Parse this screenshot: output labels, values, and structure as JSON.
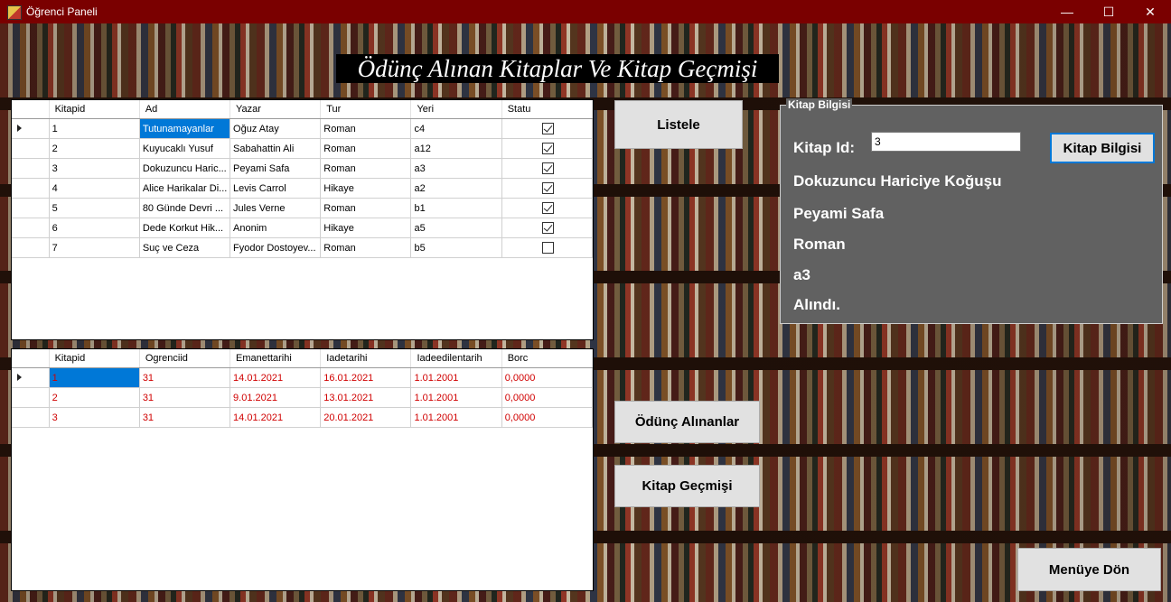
{
  "window": {
    "title": "Öğrenci Paneli",
    "minimize": "—",
    "maximize": "☐",
    "close": "✕"
  },
  "heading": "Ödünç Alınan Kitaplar Ve Kitap Geçmişi",
  "books_grid": {
    "columns": [
      "Kitapid",
      "Ad",
      "Yazar",
      "Tur",
      "Yeri",
      "Statu"
    ],
    "rows": [
      {
        "id": "1",
        "ad": "Tutunamayanlar",
        "yazar": "Oğuz Atay",
        "tur": "Roman",
        "yeri": "c4",
        "statu": true
      },
      {
        "id": "2",
        "ad": "Kuyucaklı Yusuf",
        "yazar": "Sabahattin Ali",
        "tur": "Roman",
        "yeri": "a12",
        "statu": true
      },
      {
        "id": "3",
        "ad": "Dokuzuncu Haric...",
        "yazar": "Peyami Safa",
        "tur": "Roman",
        "yeri": "a3",
        "statu": true
      },
      {
        "id": "4",
        "ad": "Alice Harikalar Di...",
        "yazar": "Levis Carrol",
        "tur": "Hikaye",
        "yeri": "a2",
        "statu": true
      },
      {
        "id": "5",
        "ad": "80 Günde Devri ...",
        "yazar": "Jules Verne",
        "tur": "Roman",
        "yeri": "b1",
        "statu": true
      },
      {
        "id": "6",
        "ad": "Dede Korkut Hik...",
        "yazar": "Anonim",
        "tur": "Hikaye",
        "yeri": "a5",
        "statu": true
      },
      {
        "id": "7",
        "ad": "Suç ve Ceza",
        "yazar": "Fyodor Dostoyev...",
        "tur": "Roman",
        "yeri": "b5",
        "statu": false
      }
    ]
  },
  "loans_grid": {
    "columns": [
      "Kitapid",
      "Ogrenciid",
      "Emanettarihi",
      "Iadetarihi",
      "Iadeedilentarih",
      "Borc"
    ],
    "rows": [
      {
        "kitapid": "1",
        "ogrenciid": "31",
        "emanet": "14.01.2021",
        "iade": "16.01.2021",
        "iadeedilen": "1.01.2001",
        "borc": "0,0000"
      },
      {
        "kitapid": "2",
        "ogrenciid": "31",
        "emanet": "9.01.2021",
        "iade": "13.01.2021",
        "iadeedilen": "1.01.2001",
        "borc": "0,0000"
      },
      {
        "kitapid": "3",
        "ogrenciid": "31",
        "emanet": "14.01.2021",
        "iade": "20.01.2021",
        "iadeedilen": "1.01.2001",
        "borc": "0,0000"
      }
    ]
  },
  "buttons": {
    "listele": "Listele",
    "odunc": "Ödünç Alınanlar",
    "gecmis": "Kitap Geçmişi",
    "menu": "Menüye Dön"
  },
  "book_info": {
    "legend": "Kitap Bilgisi",
    "id_label": "Kitap Id:",
    "id_value": "3",
    "button": "Kitap Bilgisi",
    "name": "Dokuzuncu Hariciye Koğuşu",
    "author": "Peyami Safa",
    "type": "Roman",
    "location": "a3",
    "status": "Alındı."
  }
}
